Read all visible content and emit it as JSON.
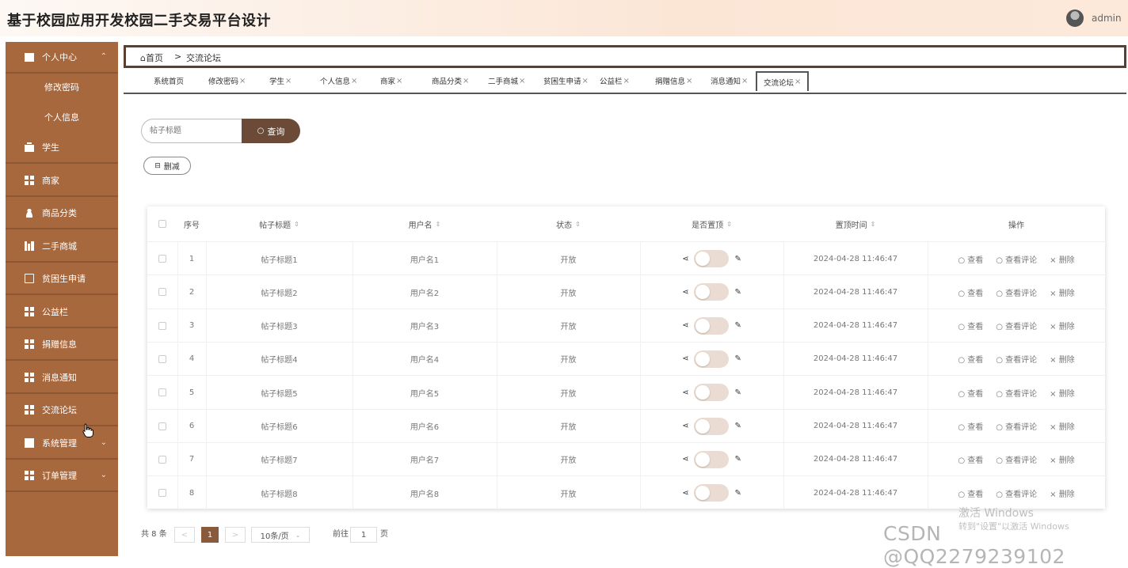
{
  "app": {
    "title": "基于校园应用开发校园二手交易平台设计",
    "user": "admin"
  },
  "sidebar": {
    "items": [
      {
        "label": "个人中心",
        "icon": "id-card-icon",
        "expanded": true
      },
      {
        "label": "修改密码",
        "sub": true
      },
      {
        "label": "个人信息",
        "sub": true
      },
      {
        "label": "学生",
        "icon": "briefcase-icon"
      },
      {
        "label": "商家",
        "icon": "grid-icon"
      },
      {
        "label": "商品分类",
        "icon": "user-icon"
      },
      {
        "label": "二手商城",
        "icon": "bars-icon"
      },
      {
        "label": "贫困生申请",
        "icon": "box-icon"
      },
      {
        "label": "公益栏",
        "icon": "grid-icon"
      },
      {
        "label": "捐赠信息",
        "icon": "grid-icon"
      },
      {
        "label": "消息通知",
        "icon": "grid-icon"
      },
      {
        "label": "交流论坛",
        "icon": "grid-icon"
      },
      {
        "label": "系统管理",
        "icon": "chart-icon",
        "expandable": true
      },
      {
        "label": "订单管理",
        "icon": "grid-icon",
        "expandable": true
      }
    ]
  },
  "breadcrumb": {
    "home": "首页",
    "separator": ">",
    "current": "交流论坛"
  },
  "tabs": [
    {
      "label": "系统首页",
      "closable": false
    },
    {
      "label": "修改密码",
      "closable": true
    },
    {
      "label": "学生",
      "closable": true
    },
    {
      "label": "个人信息",
      "closable": true
    },
    {
      "label": "商家",
      "closable": true
    },
    {
      "label": "商品分类",
      "closable": true
    },
    {
      "label": "二手商城",
      "closable": true
    },
    {
      "label": "贫困生申请",
      "closable": true
    },
    {
      "label": "公益栏",
      "closable": true
    },
    {
      "label": "捐赠信息",
      "closable": true
    },
    {
      "label": "消息通知",
      "closable": true
    },
    {
      "label": "交流论坛",
      "closable": true,
      "active": true
    }
  ],
  "toolbar": {
    "search_placeholder": "帖子标题",
    "search_label": "查询",
    "delete_label": "删减"
  },
  "table": {
    "headers": [
      "序号",
      "帖子标题",
      "用户名",
      "状态",
      "是否置顶",
      "置顶时间",
      "操作"
    ],
    "rows": [
      {
        "index": "1",
        "title": "帖子标题1",
        "user": "用户名1",
        "status": "开放",
        "time": "2024-04-28 11:46:47"
      },
      {
        "index": "2",
        "title": "帖子标题2",
        "user": "用户名2",
        "status": "开放",
        "time": "2024-04-28 11:46:47"
      },
      {
        "index": "3",
        "title": "帖子标题3",
        "user": "用户名3",
        "status": "开放",
        "time": "2024-04-28 11:46:47"
      },
      {
        "index": "4",
        "title": "帖子标题4",
        "user": "用户名4",
        "status": "开放",
        "time": "2024-04-28 11:46:47"
      },
      {
        "index": "5",
        "title": "帖子标题5",
        "user": "用户名5",
        "status": "开放",
        "time": "2024-04-28 11:46:47"
      },
      {
        "index": "6",
        "title": "帖子标题6",
        "user": "用户名6",
        "status": "开放",
        "time": "2024-04-28 11:46:47"
      },
      {
        "index": "7",
        "title": "帖子标题7",
        "user": "用户名7",
        "status": "开放",
        "time": "2024-04-28 11:46:47"
      },
      {
        "index": "8",
        "title": "帖子标题8",
        "user": "用户名8",
        "status": "开放",
        "time": "2024-04-28 11:46:47"
      }
    ],
    "actions": {
      "view": "查看",
      "view_comments": "查看评论",
      "delete": "删除"
    }
  },
  "pagination": {
    "total": "共 8 条",
    "current_page": "1",
    "page_size": "10条/页",
    "goto_prefix": "前往",
    "goto_value": "1",
    "goto_suffix": "页"
  },
  "overlay": {
    "csdn_watermark": "CSDN @QQ2279239102",
    "windows_activate": "激活 Windows",
    "windows_hint": "转到\"设置\"以激活 Windows"
  },
  "colors": {
    "sidebar": "#a8683e",
    "accent": "#6b4a38",
    "header_gradient_end": "#fbe6d6"
  }
}
